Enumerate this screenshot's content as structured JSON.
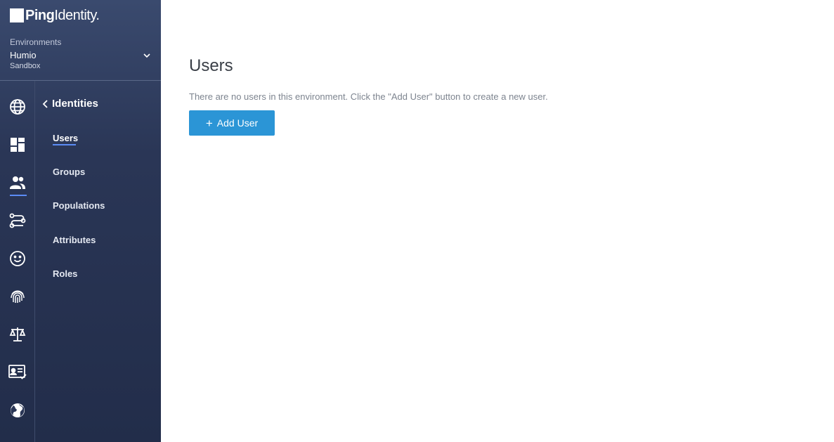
{
  "brand": {
    "logo_bold": "Ping",
    "logo_light": "Identity",
    "logo_suffix": "."
  },
  "environment": {
    "label": "Environments",
    "name": "Humio",
    "type": "Sandbox"
  },
  "rail_icons": [
    "globe-icon",
    "dashboard-icon",
    "users-icon",
    "connections-icon",
    "smiley-icon",
    "fingerprint-icon",
    "scale-icon",
    "id-card-icon",
    "world-icon"
  ],
  "subnav": {
    "title": "Identities",
    "items": [
      {
        "label": "Users",
        "active": true
      },
      {
        "label": "Groups"
      },
      {
        "label": "Populations"
      },
      {
        "label": "Attributes"
      },
      {
        "label": "Roles"
      }
    ]
  },
  "main": {
    "title": "Users",
    "empty_message": "There are no users in this environment. Click the \"Add User\" button to create a new user.",
    "add_button": {
      "icon": "+",
      "label": "Add User"
    }
  },
  "colors": {
    "accent": "#2b95d6",
    "sidebar": "#2a3656",
    "highlight": "#5b8cf5"
  }
}
